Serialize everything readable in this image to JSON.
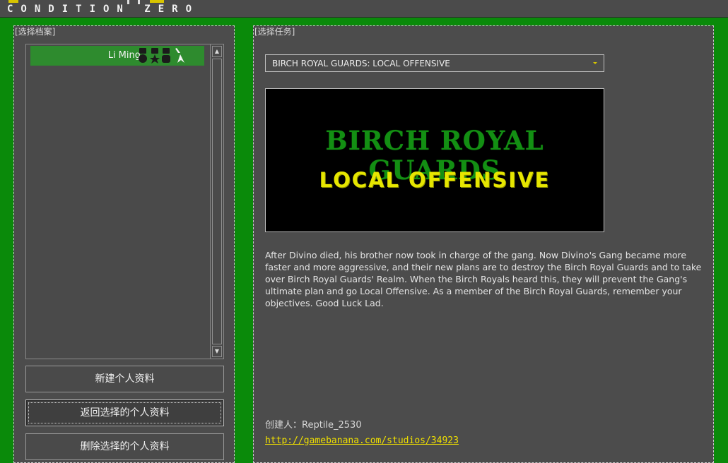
{
  "header": {
    "logo_text": "CONDITION ZERO"
  },
  "left_panel": {
    "title": "[选择档案]",
    "profiles": [
      {
        "name": "Li Ming"
      }
    ],
    "buttons": {
      "new_profile": "新建个人资料",
      "return_profile": "返回选择的个人资料",
      "delete_profile": "删除选择的个人资料"
    }
  },
  "right_panel": {
    "title": "[选择任务]",
    "mission_select": {
      "selected": "BIRCH ROYAL GUARDS: LOCAL OFFENSIVE"
    },
    "banner": {
      "line1": "BIRCH ROYAL GUARDS",
      "line2": "LOCAL OFFENSIVE"
    },
    "description": "After Divino died, his brother now took in charge of the gang. Now Divino's Gang became more faster and more aggressive, and their new plans are to destroy the Birch Royal Guards and to take over Birch Royal Guards' Realm. When the Birch Royals heard this, they will prevent the Gang's ultimate plan and go Local Offensive. As a member of the Birch Royal Guards, remember your objectives. Good Luck Lad.",
    "author": "创建人：Reptile_2530",
    "link": "http://gamebanana.com/studios/34923"
  },
  "colors": {
    "background": "#0a8a0a",
    "panel": "#4c4c4c",
    "selected_row": "#2e8b2e",
    "link": "#f0e000"
  }
}
